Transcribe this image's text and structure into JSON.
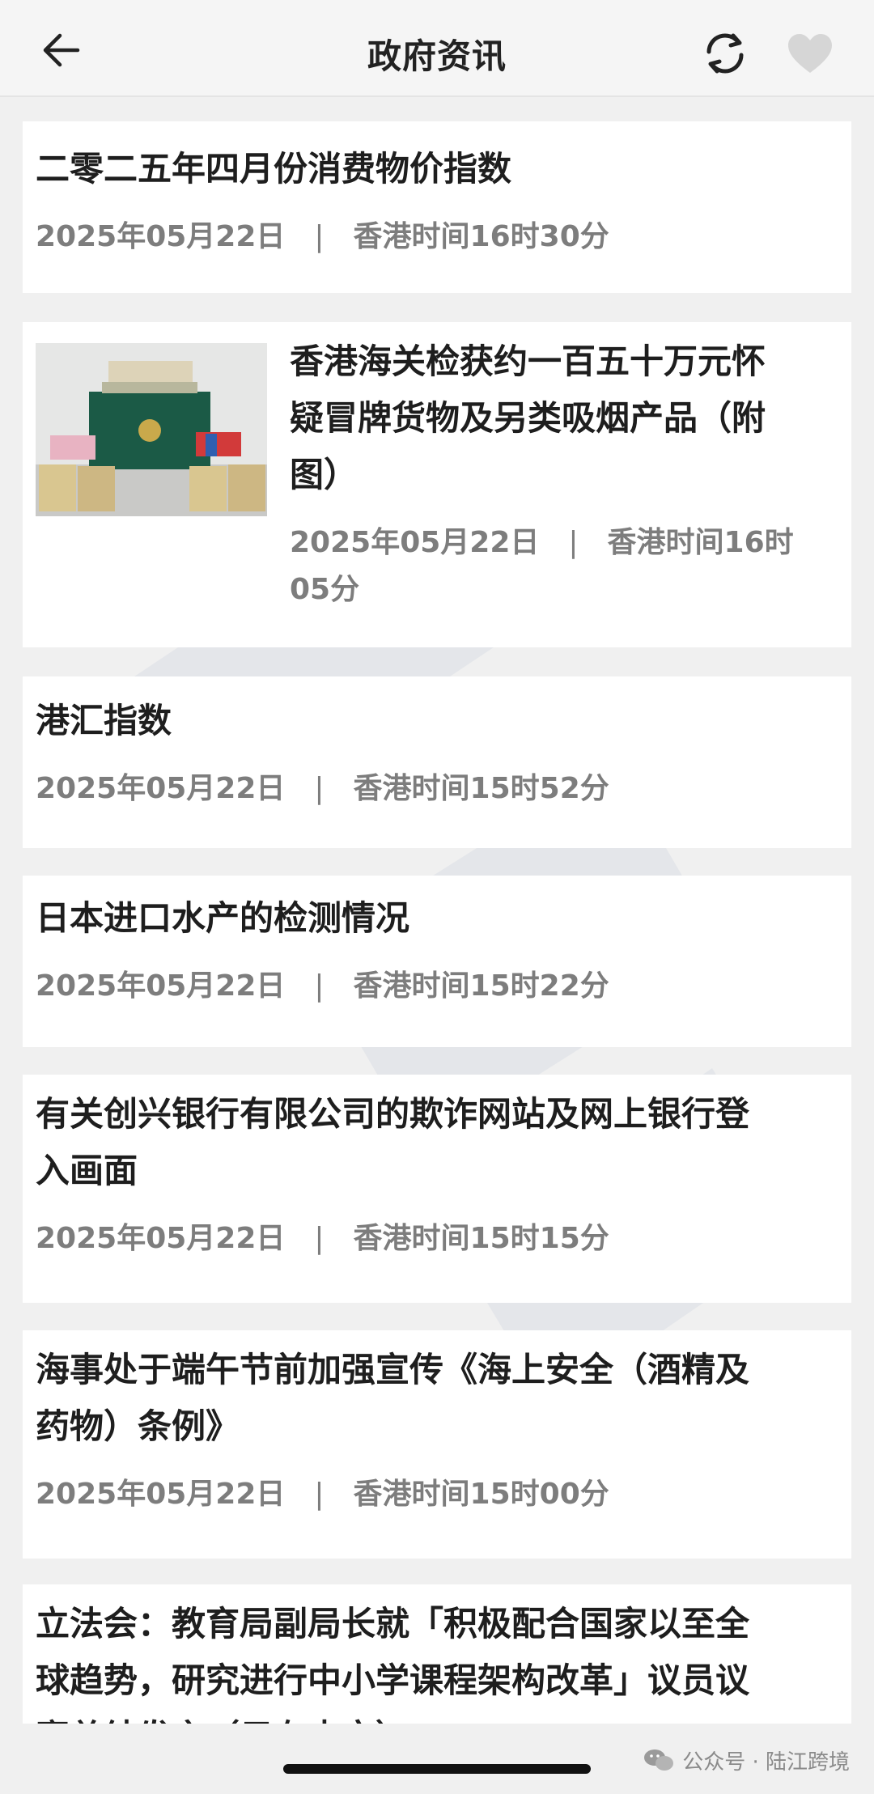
{
  "header": {
    "title": "政府资讯",
    "back_icon": "back-arrow-icon",
    "refresh_icon": "refresh-icon",
    "favorite_icon": "heart-icon"
  },
  "articles": [
    {
      "title": "二零二五年四月份消费物价指数",
      "date": "2025年05月22日",
      "time": "香港时间16时30分"
    },
    {
      "title": "香港海关检获约一百五十万元怀疑冒牌货物及另类吸烟产品（附图）",
      "title_line1": "香港海关检获约一百五十万元怀",
      "title_line2": "疑冒牌货物及另类吸烟产品（附",
      "title_line3": "图）",
      "date": "2025年05月22日",
      "time_line1": "香港时间16时",
      "time_line2": "05分",
      "has_image": true
    },
    {
      "title": "港汇指数",
      "date": "2025年05月22日",
      "time": "香港时间15时52分"
    },
    {
      "title": "日本进口水产的检测情况",
      "date": "2025年05月22日",
      "time": "香港时间15时22分"
    },
    {
      "title_line1": "有关创兴银行有限公司的欺诈网站及网上银行登",
      "title_line2": "入画面",
      "date": "2025年05月22日",
      "time": "香港时间15时15分"
    },
    {
      "title_line1": "海事处于端午节前加强宣传《海上安全（酒精及",
      "title_line2": "药物）条例》",
      "date": "2025年05月22日",
      "time": "香港时间15时00分"
    },
    {
      "title_line1": "立法会：教育局副局长就「积极配合国家以至全",
      "title_line2": "球趋势，研究进行中小学课程架构改革」议员议",
      "title_line3": "案总结发言（只有中文）"
    }
  ],
  "separator": "|",
  "footer": {
    "watermark": "公众号 · 陆江跨境",
    "wechat_icon": "wechat-icon"
  },
  "colors": {
    "background": "#f0f0f0",
    "card": "#ffffff",
    "title": "#1e1e1e",
    "meta": "#7d7d7d"
  }
}
